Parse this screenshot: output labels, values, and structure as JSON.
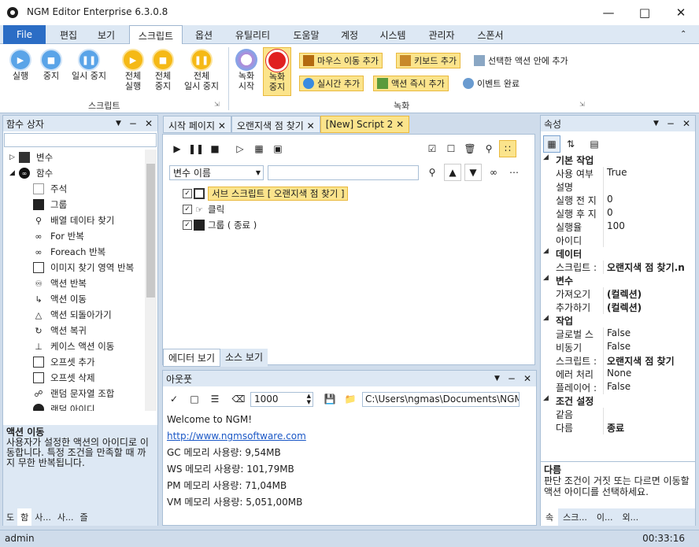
{
  "window": {
    "title": "NGM Editor    Enterprise 6.3.0.8"
  },
  "menu": [
    "File",
    "편집",
    "보기",
    "스크립트",
    "옵션",
    "유틸리티",
    "도움말",
    "계정",
    "시스템",
    "관리자",
    "스폰서"
  ],
  "ribbon": {
    "run": "실행",
    "stop": "중지",
    "pause": "일시 중지",
    "all_run": [
      "전체",
      "실행"
    ],
    "all_stop": [
      "전체",
      "중지"
    ],
    "all_pause": [
      "전체",
      "일시 중지"
    ],
    "rec_start": [
      "녹화",
      "시작"
    ],
    "rec_stop": [
      "녹화",
      "중지"
    ],
    "mouse_move": "마우스 이동 추가",
    "keyboard": "키보드 추가",
    "in_action": "선택한 액션 안에 추가",
    "realtime": "실시간 추가",
    "action_now": "액션 즉시 추가",
    "event_done": "이벤트 완료",
    "group_script": "스크립트",
    "group_record": "녹화"
  },
  "left_panel": {
    "title": "함수 상자",
    "tree": [
      "변수",
      "함수",
      "주석",
      "그룹",
      "배열 데이타 찾기",
      "For 반복",
      "Foreach 반복",
      "이미지 찾기 영역 반복",
      "액션 반복",
      "액션 이동",
      "액션 되돌아가기",
      "액션 복귀",
      "케이스 액션 이동",
      "오프셋 추가",
      "오프셋 삭제",
      "랜덤 문자열 조합",
      "랜덤 아이디"
    ],
    "desc_title": "액션 이동",
    "desc_text": "사용자가 설정한 액션의 아이디로 이동합니다. 특정 조건을 만족할 때 까지 무한 반복됩니다.",
    "bottom_tabs": [
      "도",
      "함",
      "사...",
      "사...",
      "즐"
    ]
  },
  "center": {
    "tabs": [
      "시작 페이지",
      "오랜지색 점 찾기",
      "[New] Script 2"
    ],
    "var_select": "변수 이름",
    "script_rows": [
      "서브 스크립트 [ 오랜지색 점 찾기 ]",
      "클릭",
      "그룹 ( 종료 )"
    ],
    "view_tabs": [
      "에디터 보기",
      "소스 보기"
    ]
  },
  "output": {
    "title": "아웃풋",
    "zoom": "1000",
    "path": "C:\\Users\\ngmas\\Documents\\NGM6\\",
    "lines": [
      "Welcome to NGM!",
      "http://www.ngmsoftware.com",
      "GC 메모리 사용량: 9,54MB",
      "WS 메모리 사용량: 101,79MB",
      "PM 메모리 사용량: 71,04MB",
      "VM 메모리 사용량: 5,051,00MB"
    ]
  },
  "props": {
    "title": "속성",
    "rows": [
      {
        "cat": "기본 작업"
      },
      {
        "k": "사용 여부",
        "v": "True"
      },
      {
        "k": "설명",
        "v": ""
      },
      {
        "k": "실행 전 지",
        "v": "0"
      },
      {
        "k": "실행 후 지",
        "v": "0"
      },
      {
        "k": "실행율",
        "v": "100"
      },
      {
        "k": "아이디",
        "v": ""
      },
      {
        "cat": "데이터"
      },
      {
        "k": "스크립트 :",
        "v": "오랜지색 점 찾기.n",
        "b": true
      },
      {
        "cat": "변수"
      },
      {
        "k": "가져오기",
        "v": "(컬렉션)",
        "b": true
      },
      {
        "k": "추가하기",
        "v": "(컬렉션)",
        "b": true
      },
      {
        "cat": "작업"
      },
      {
        "k": "글로벌 스",
        "v": "False"
      },
      {
        "k": "비동기",
        "v": "False"
      },
      {
        "k": "스크립트 :",
        "v": "오랜지색 점 찾기",
        "b": true
      },
      {
        "k": "에러 처리",
        "v": "None"
      },
      {
        "k": "플레이어 :",
        "v": "False"
      },
      {
        "cat": "조건 설정"
      },
      {
        "k": "같음",
        "v": ""
      },
      {
        "k": "다름",
        "v": "종료",
        "b": true
      }
    ],
    "desc_title": "다름",
    "desc_text": "판단 조건이 거짓 또는 다르면 이동할 액션 아이디를 선택하세요.",
    "bottom_tabs": [
      "속",
      "스크...",
      "이...",
      "외..."
    ]
  },
  "status": {
    "user": "admin",
    "time": "00:33:16"
  },
  "colors": {
    "accent": "#2b6dc5",
    "highlight": "#fbe48c",
    "panel": "#dde8f4"
  }
}
